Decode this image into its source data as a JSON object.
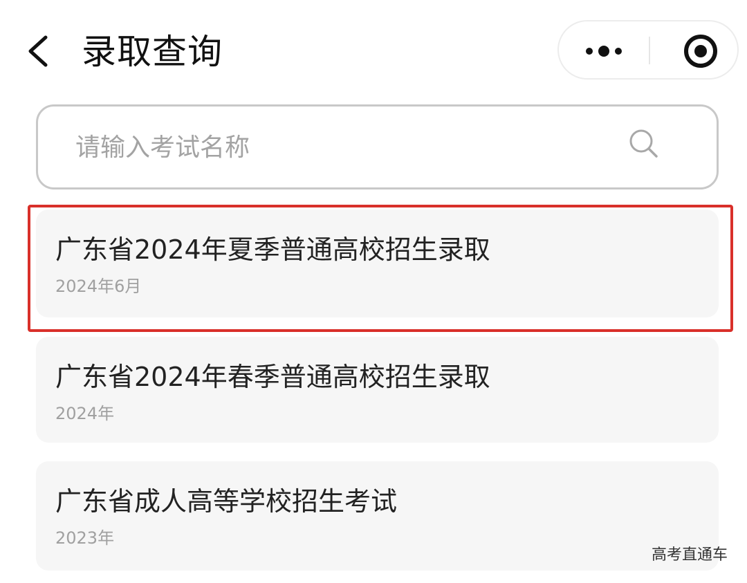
{
  "header": {
    "title": "录取查询",
    "back_icon": "chevron-left-icon",
    "more_icon": "more-dots-icon",
    "close_icon": "target-close-icon"
  },
  "search": {
    "placeholder": "请输入考试名称",
    "value": "",
    "icon": "search-icon"
  },
  "exams": [
    {
      "title": "广东省2024年夏季普通高校招生录取",
      "date": "2024年6月",
      "highlighted": true
    },
    {
      "title": "广东省2024年春季普通高校招生录取",
      "date": "2024年",
      "highlighted": false
    },
    {
      "title": "广东省成人高等学校招生考试",
      "date": "2023年",
      "highlighted": false
    }
  ],
  "colors": {
    "highlight": "#d9302a",
    "card_background": "#f6f6f6",
    "secondary_text": "#a0a0a0"
  },
  "watermark": "高考直通车"
}
